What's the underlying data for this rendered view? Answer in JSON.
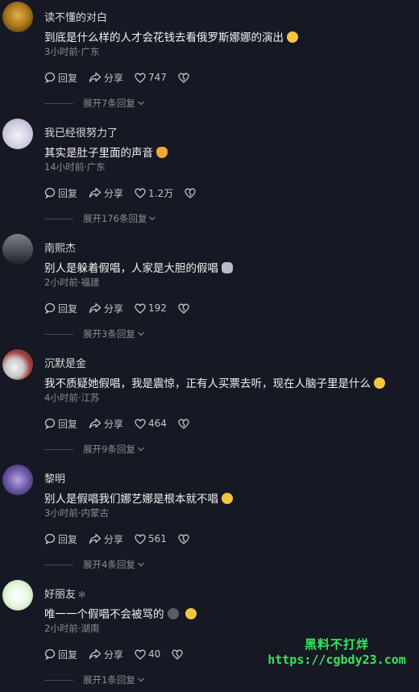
{
  "comments": [
    {
      "username": "读不懂的对白",
      "content": "到底是什么样的人才会花钱去看俄罗斯娜娜的演出",
      "meta": "3小时前·广东",
      "reply": "回复",
      "share": "分享",
      "likes": "747",
      "expand": "展开7条回复"
    },
    {
      "username": "我已经很努力了",
      "content": "其实是肚子里面的声音",
      "meta": "14小时前·广东",
      "reply": "回复",
      "share": "分享",
      "likes": "1.2万",
      "expand": "展开176条回复"
    },
    {
      "username": "南熙杰",
      "content": "别人是躲着假唱，人家是大胆的假唱",
      "meta": "2小时前·福建",
      "reply": "回复",
      "share": "分享",
      "likes": "192",
      "expand": "展开3条回复"
    },
    {
      "username": "沉默是金",
      "content": "我不质疑她假唱，我是震惊，正有人买票去听，现在人脑子里是什么",
      "meta": "4小时前·江苏",
      "reply": "回复",
      "share": "分享",
      "likes": "464",
      "expand": "展开9条回复"
    },
    {
      "username": "黎明",
      "content": "别人是假唱我们娜艺娜是根本就不唱",
      "meta": "3小时前·内蒙古",
      "reply": "回复",
      "share": "分享",
      "likes": "561",
      "expand": "展开4条回复"
    },
    {
      "username": "好丽友",
      "content": "唯一一个假唱不会被骂的",
      "meta": "2小时前·湖南",
      "reply": "回复",
      "share": "分享",
      "likes": "40",
      "expand": "展开1条回复"
    }
  ],
  "watermark": {
    "line1": "黑料不打烊",
    "line2": "https://cgbdy23.com"
  },
  "colors": {
    "background": "#161823",
    "watermark": "#37e65d"
  }
}
